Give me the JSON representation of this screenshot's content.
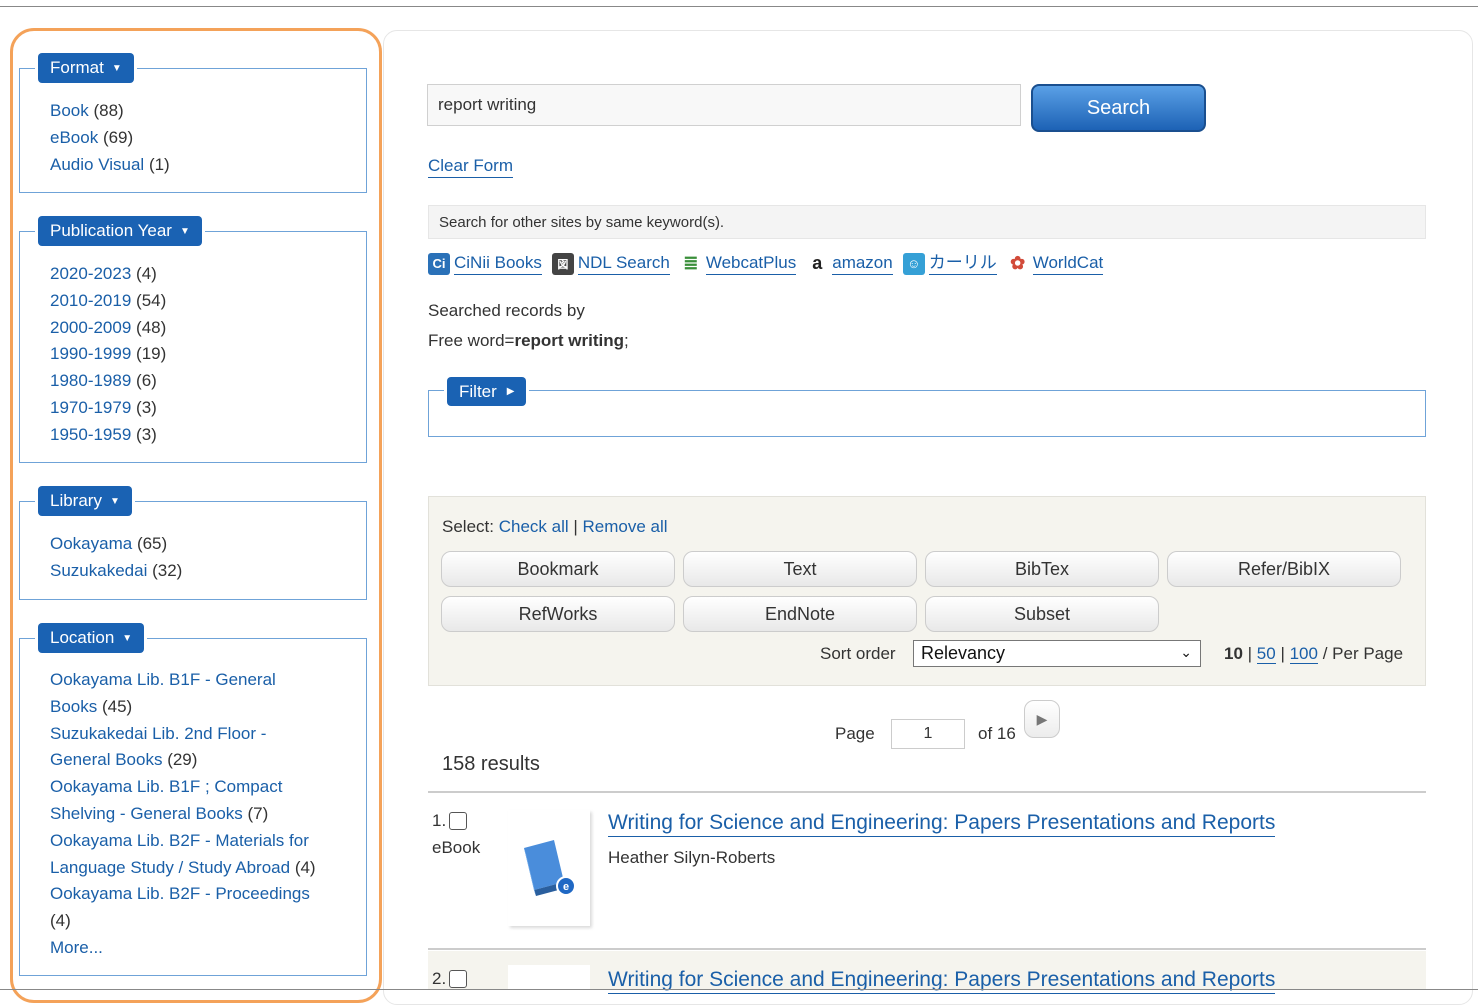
{
  "facets": {
    "format": {
      "label": "Format",
      "items": [
        {
          "name": "Book",
          "count": "(88)"
        },
        {
          "name": "eBook",
          "count": "(69)"
        },
        {
          "name": "Audio Visual",
          "count": "(1)"
        }
      ]
    },
    "year": {
      "label": "Publication Year",
      "items": [
        {
          "name": "2020-2023",
          "count": "(4)"
        },
        {
          "name": "2010-2019",
          "count": "(54)"
        },
        {
          "name": "2000-2009",
          "count": "(48)"
        },
        {
          "name": "1990-1999",
          "count": "(19)"
        },
        {
          "name": "1980-1989",
          "count": "(6)"
        },
        {
          "name": "1970-1979",
          "count": "(3)"
        },
        {
          "name": "1950-1959",
          "count": "(3)"
        }
      ]
    },
    "library": {
      "label": "Library",
      "items": [
        {
          "name": "Ookayama",
          "count": "(65)"
        },
        {
          "name": "Suzukakedai",
          "count": "(32)"
        }
      ]
    },
    "location": {
      "label": "Location",
      "lines": [
        {
          "link": "Ookayama Lib. B1F - General",
          "count": ""
        },
        {
          "link": "Books",
          "count": "(45)"
        },
        {
          "link": "Suzukakedai Lib. 2nd Floor -",
          "count": ""
        },
        {
          "link": "General Books",
          "count": "(29)"
        },
        {
          "link": "Ookayama Lib. B1F ; Compact",
          "count": ""
        },
        {
          "link": "Shelving - General Books",
          "count": "(7)"
        },
        {
          "link": "Ookayama Lib. B2F - Materials for",
          "count": ""
        },
        {
          "link": "Language Study / Study Abroad",
          "count": "(4)"
        },
        {
          "link": "Ookayama Lib. B2F - Proceedings",
          "count": ""
        },
        {
          "link": "",
          "count": "(4)"
        },
        {
          "link": "More...",
          "count": ""
        }
      ]
    }
  },
  "search": {
    "value": "report writing",
    "button": "Search",
    "clear": "Clear Form",
    "other_sites_label": "Search for other sites by same keyword(s).",
    "sites": [
      {
        "name": "CiNii Books",
        "icon": "cinii-icon",
        "glyph": "Ci"
      },
      {
        "name": "NDL Search",
        "icon": "ndl-icon",
        "glyph": "図"
      },
      {
        "name": "WebcatPlus",
        "icon": "webcat-icon",
        "glyph": "≣"
      },
      {
        "name": "amazon",
        "icon": "amazon-icon",
        "glyph": "a"
      },
      {
        "name": "カーリル",
        "icon": "calil-icon",
        "glyph": "☺"
      },
      {
        "name": "WorldCat",
        "icon": "worldcat-icon",
        "glyph": "✿"
      }
    ],
    "searched_by": "Searched records by",
    "freeword_prefix": "Free word=",
    "freeword_value": "report writing",
    "freeword_suffix": ";"
  },
  "filter": {
    "label": "Filter"
  },
  "actions": {
    "select_label": "Select:",
    "check_all": "Check all",
    "sep": "|",
    "remove_all": "Remove all",
    "buttons": [
      "Bookmark",
      "Text",
      "BibTex",
      "Refer/BibIX",
      "RefWorks",
      "EndNote",
      "Subset"
    ],
    "sort_label": "Sort order",
    "sort_value": "Relevancy",
    "perpage_current": "10",
    "perpage_50": "50",
    "perpage_100": "100",
    "perpage_suffix": "/ Per Page"
  },
  "paging": {
    "label": "Page",
    "value": "1",
    "of": "of 16"
  },
  "results": {
    "count_text": "158 results",
    "records": [
      {
        "num": "1.",
        "type": "eBook",
        "title": "Writing for Science and Engineering: Papers Presentations and Reports",
        "author": "Heather Silyn-Roberts"
      },
      {
        "num": "2.",
        "type": "",
        "title": "Writing for Science and Engineering: Papers Presentations and Reports",
        "author": ""
      }
    ]
  },
  "colors": {
    "accent": "#1a62b3",
    "highlight": "#f4a259",
    "link": "#1a5fa8"
  }
}
